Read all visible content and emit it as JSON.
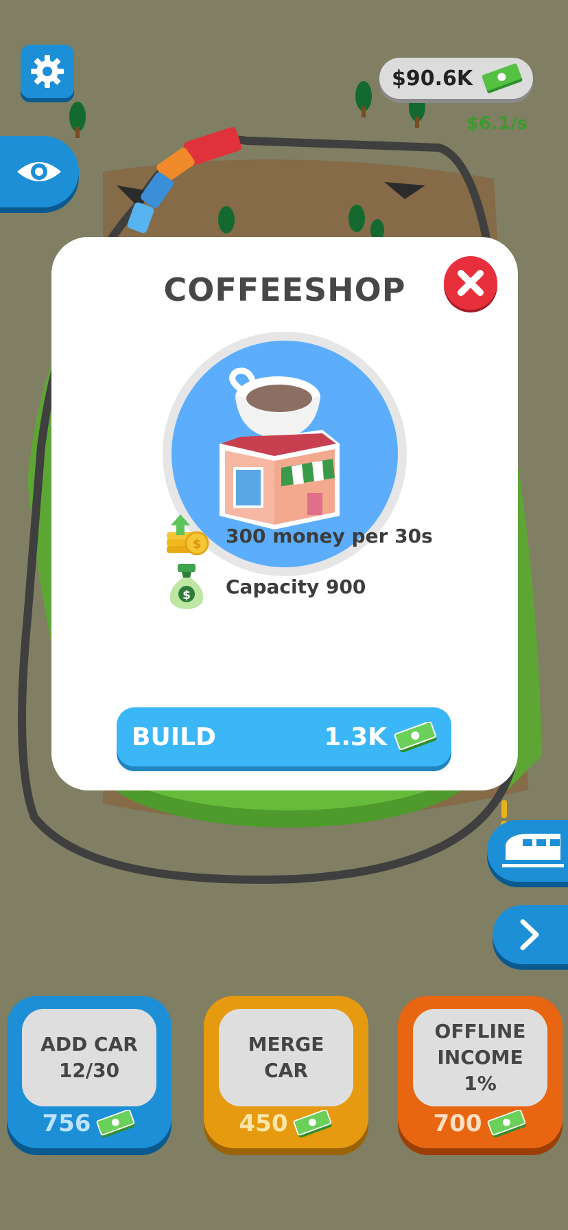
{
  "hud": {
    "balance": "$90.6K",
    "income_rate": "$6.1/s"
  },
  "modal": {
    "title": "COFFEESHOP",
    "stats": [
      {
        "label": "300 money per 30s",
        "icon": "coins-upgrade-icon"
      },
      {
        "label": "Capacity 900",
        "icon": "money-bag-icon"
      }
    ],
    "build": {
      "label": "BUILD",
      "cost": "1.3K"
    }
  },
  "cards": [
    {
      "lines": [
        "ADD CAR",
        "12/30"
      ],
      "price": "756",
      "color": "#1d8fd6",
      "shadow": "#0b5a8f",
      "price_color": "#bfe3ff"
    },
    {
      "lines": [
        "MERGE",
        "CAR"
      ],
      "price": "450",
      "color": "#e69a10",
      "shadow": "#9a6306",
      "price_color": "#ffe6a8"
    },
    {
      "lines": [
        "OFFLINE",
        "INCOME",
        "1%"
      ],
      "price": "700",
      "color": "#e86612",
      "shadow": "#9c3f06",
      "price_color": "#ffe0c4"
    }
  ],
  "icons": {
    "settings": "gear-icon",
    "view": "eye-icon",
    "close": "close-icon",
    "train": "train-icon",
    "next": "chevron-right-icon",
    "cash": "cash-bill-icon"
  }
}
